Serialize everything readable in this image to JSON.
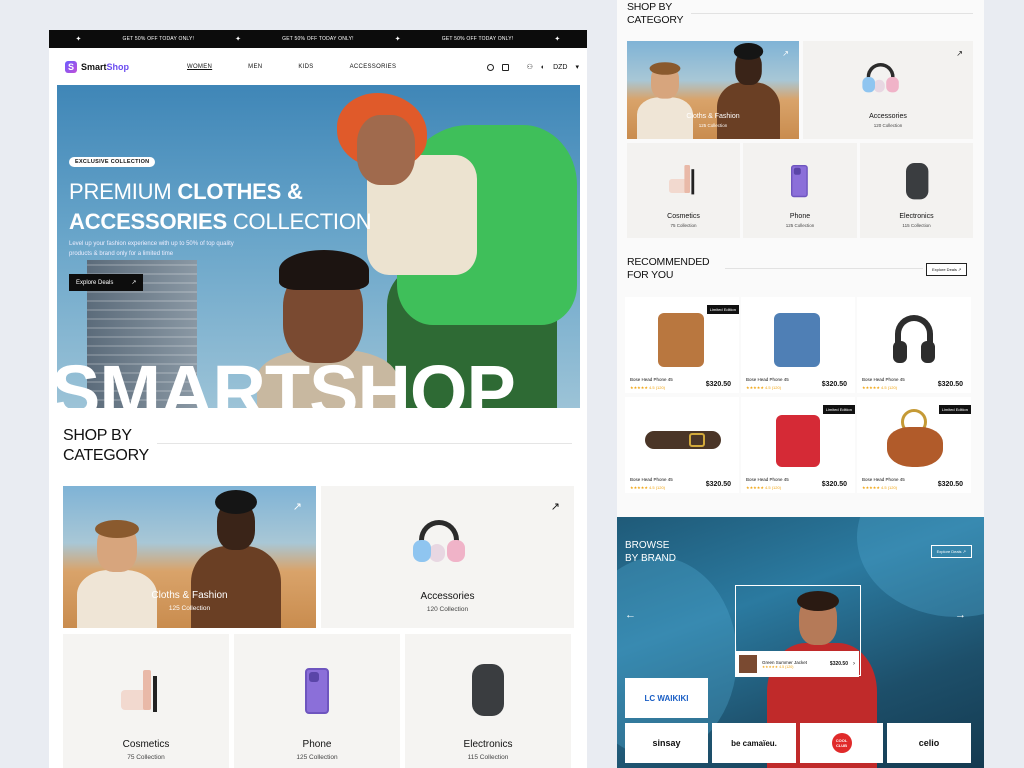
{
  "promo": {
    "text1": "GET 50% OFF TODAY ONLY!",
    "text2": "GET 50% OFF TODAY ONLY!",
    "text3": "GET 50% OFF TODAY ONLY!"
  },
  "nav": {
    "logo_a": "Smart",
    "logo_b": "Shop",
    "menu": [
      "WOMEN",
      "MEN",
      "KIDS",
      "ACCESSORIES"
    ],
    "currency": "DZD"
  },
  "hero": {
    "badge": "EXCLUSIVE COLLECTION",
    "title_a": "PREMIUM ",
    "title_b": "CLOTHES &",
    "title_c": "ACCESSORIES",
    "title_d": " COLLECTION",
    "desc": "Level up your fashion experience with up to 50% of top quality products & brand only for a limited time",
    "cta": "Explore Deals",
    "big_word": "SMARTSHOP"
  },
  "shop_by_category": {
    "title_1": "SHOP BY",
    "title_2": "CATEGORY",
    "items": [
      {
        "name": "Cloths & Fashion",
        "count": "125 Collection"
      },
      {
        "name": "Accessories",
        "count": "120 Collection"
      },
      {
        "name": "Cosmetics",
        "count": "75 Collection"
      },
      {
        "name": "Phone",
        "count": "125 Collection"
      },
      {
        "name": "Electronics",
        "count": "115 Collection"
      }
    ]
  },
  "recommended": {
    "title_1": "RECOMMENDED",
    "title_2": "FOR YOU",
    "explore": "Explore Deals",
    "badge": "Limited Edition",
    "products": [
      {
        "name": "Bose Head Phone 45",
        "rating": "★★★★★ 4.5 (120)",
        "price": "$320.50"
      },
      {
        "name": "Bose Head Phone 45",
        "rating": "★★★★★ 4.5 (120)",
        "price": "$320.50"
      },
      {
        "name": "Bose Head Phone 45",
        "rating": "★★★★★ 4.5 (120)",
        "price": "$320.50"
      },
      {
        "name": "Bose Head Phone 45",
        "rating": "★★★★★ 4.5 (120)",
        "price": "$320.50"
      },
      {
        "name": "Bose Head Phone 45",
        "rating": "★★★★★ 4.5 (120)",
        "price": "$320.50"
      },
      {
        "name": "Bose Head Phone 45",
        "rating": "★★★★★ 4.5 (120)",
        "price": "$320.50"
      }
    ]
  },
  "brands": {
    "title_1": "BROWSE",
    "title_2": "BY BRAND",
    "explore": "Explore Deals",
    "product_name": "Green Summer Jacket",
    "product_rating": "★★★★★ 4.5 (120)",
    "product_price": "$320.50",
    "list": [
      "LC WAIKIKI",
      "sinsay",
      "be camaïeu.",
      "COOL CLUB",
      "celio"
    ]
  },
  "colors": {
    "accent": "#6b4cf0",
    "dark": "#0c0c0c",
    "star": "#f1a410"
  }
}
